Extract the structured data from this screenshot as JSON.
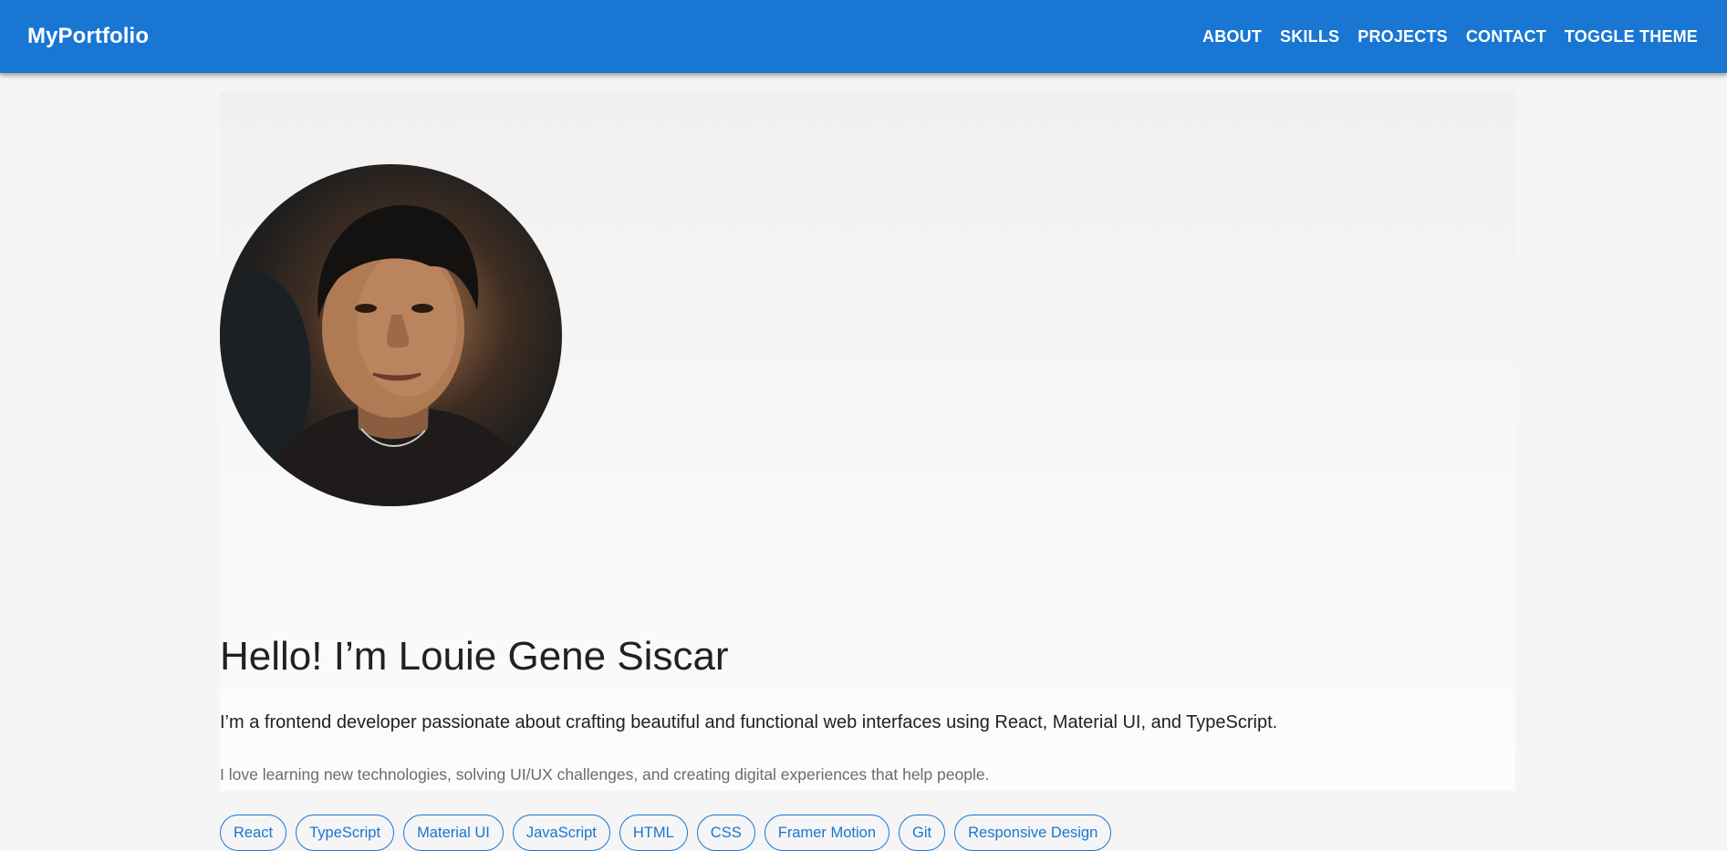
{
  "appbar": {
    "brand": "MyPortfolio",
    "nav": [
      "ABOUT",
      "SKILLS",
      "PROJECTS",
      "CONTACT",
      "TOGGLE THEME"
    ],
    "color": "#1976d2"
  },
  "hero": {
    "title": "Hello! I’m Louie Gene Siscar",
    "lead": "I’m a frontend developer passionate about crafting beautiful and functional web interfaces using React, Material UI, and TypeScript.",
    "sub": "I love learning new technologies, solving UI/UX challenges, and creating digital experiences that help people.",
    "skills": [
      "React",
      "TypeScript",
      "Material UI",
      "JavaScript",
      "HTML",
      "CSS",
      "Framer Motion",
      "Git",
      "Responsive Design"
    ]
  },
  "colors": {
    "primary": "#1976d2",
    "background": "#f5f5f5",
    "text": "#212121",
    "muted": "#6b6b6b"
  }
}
